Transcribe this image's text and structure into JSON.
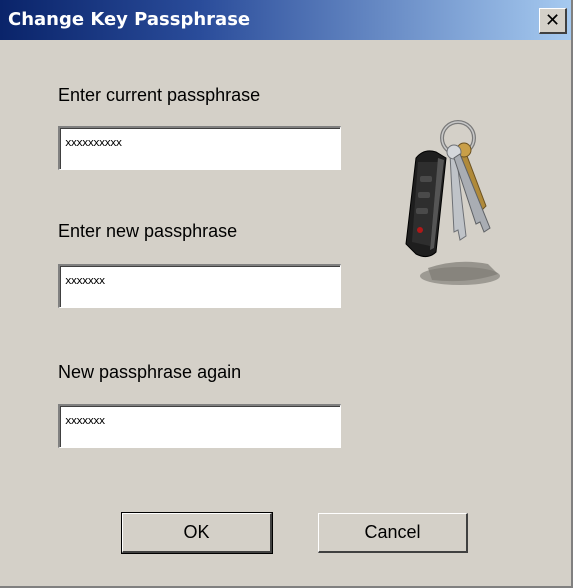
{
  "dialog": {
    "title": "Change Key Passphrase",
    "close_icon": "close-icon"
  },
  "fields": {
    "current": {
      "label": "Enter current passphrase",
      "value": "xxxxxxxxxx"
    },
    "new": {
      "label": "Enter new passphrase",
      "value": "xxxxxxx"
    },
    "confirm": {
      "label": "New passphrase again",
      "value": "xxxxxxx"
    }
  },
  "buttons": {
    "ok_label": "OK",
    "cancel_label": "Cancel"
  },
  "illustration": {
    "icon": "keychain-icon"
  },
  "colors": {
    "dialog_bg": "#d4d0c8",
    "titlebar_start": "#0a246a",
    "titlebar_end": "#a6caf0"
  }
}
